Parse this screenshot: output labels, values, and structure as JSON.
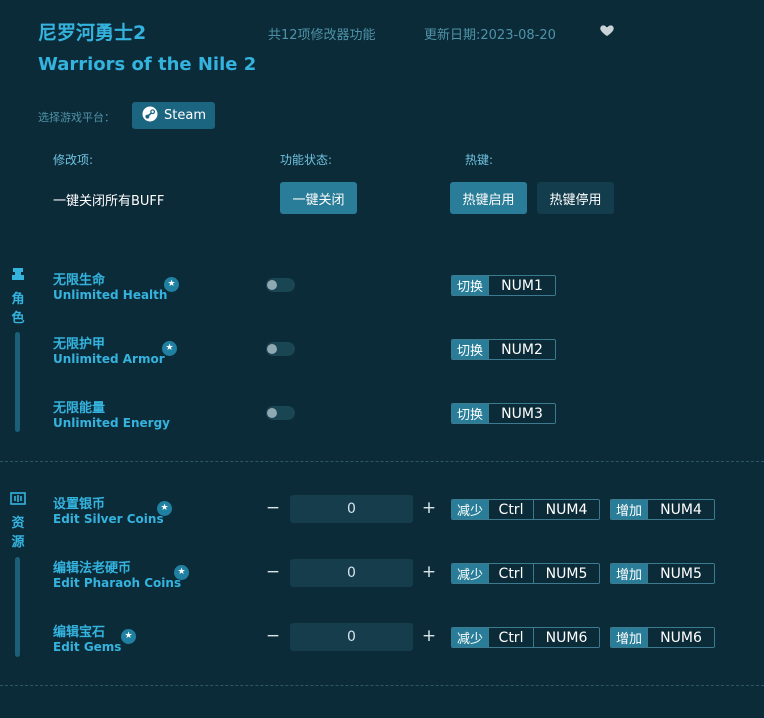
{
  "header": {
    "title_cn": "尼罗河勇士2",
    "title_en": "Warriors of the Nile 2",
    "feature_count": "共12项修改器功能",
    "update_date": "更新日期:2023-08-20"
  },
  "platform": {
    "label": "选择游戏平台：",
    "steam_label": "Steam"
  },
  "columns": {
    "mod": "修改项:",
    "status": "功能状态:",
    "hotkey": "热键:"
  },
  "global_row": {
    "label": "一键关闭所有BUFF",
    "close_all": "一键关闭",
    "hotkey_enable": "热键启用",
    "hotkey_disable": "热键停用"
  },
  "sections": {
    "character": {
      "label": "角色",
      "items": [
        {
          "cn": "无限生命",
          "en": "Unlimited Health",
          "tag": "切换",
          "key": "NUM1"
        },
        {
          "cn": "无限护甲",
          "en": "Unlimited Armor",
          "tag": "切换",
          "key": "NUM2"
        },
        {
          "cn": "无限能量",
          "en": "Unlimited Energy",
          "tag": "切换",
          "key": "NUM3"
        }
      ]
    },
    "resources": {
      "label": "资源",
      "items": [
        {
          "cn": "设置银币",
          "en": "Edit Silver Coins",
          "value": "0",
          "dec_tag": "减少",
          "dec_mod": "Ctrl",
          "dec_key": "NUM4",
          "inc_tag": "增加",
          "inc_key": "NUM4"
        },
        {
          "cn": "编辑法老硬币",
          "en": "Edit Pharaoh Coins",
          "value": "0",
          "dec_tag": "减少",
          "dec_mod": "Ctrl",
          "dec_key": "NUM5",
          "inc_tag": "增加",
          "inc_key": "NUM5"
        },
        {
          "cn": "编辑宝石",
          "en": "Edit Gems",
          "value": "0",
          "dec_tag": "减少",
          "dec_mod": "Ctrl",
          "dec_key": "NUM6",
          "inc_tag": "增加",
          "inc_key": "NUM6"
        }
      ]
    }
  },
  "symbols": {
    "minus": "−",
    "plus": "+",
    "star": "★"
  },
  "icons": {
    "favorite": "heart-icon",
    "steam": "steam-icon",
    "character": "character-icon",
    "resources": "resources-icon"
  },
  "colors": {
    "background": "#0c2b38",
    "accent": "#34b3df",
    "button": "#2a7d98"
  }
}
